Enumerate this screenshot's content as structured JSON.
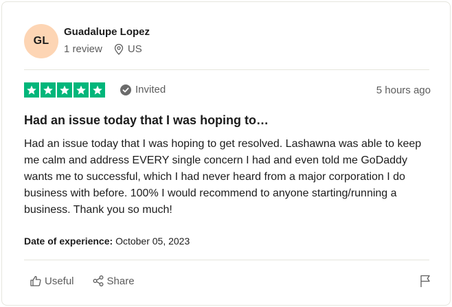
{
  "reviewer": {
    "initials": "GL",
    "name": "Guadalupe Lopez",
    "review_count": "1 review",
    "country": "US",
    "avatar_color": "#fdd5b4"
  },
  "rating": {
    "stars": 5,
    "max_stars": 5,
    "star_color": "#00b67a",
    "status": "Invited",
    "status_icon": "check-circle-icon",
    "time": "5 hours ago"
  },
  "review": {
    "title": "Had an issue today that I was hoping to…",
    "body": "Had an issue today that I was hoping to get resolved. Lashawna was able to keep me calm and address EVERY single concern I had and even told me GoDaddy wants me to successful, which I had never heard from a major corporation I do business with before. 100% I would recommend to anyone starting/running a business. Thank you so much!"
  },
  "experience": {
    "label": "Date of experience:",
    "date": "October 05, 2023"
  },
  "actions": {
    "useful_label": "Useful",
    "useful_icon": "thumbs-up-icon",
    "share_label": "Share",
    "share_icon": "share-icon",
    "flag_icon": "flag-icon"
  }
}
